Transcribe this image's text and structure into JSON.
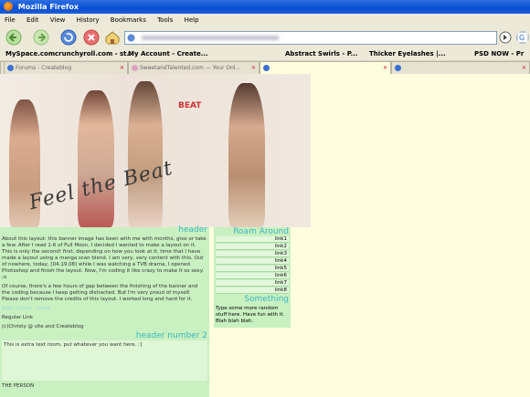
{
  "window": {
    "title": "Mozilla Firefox"
  },
  "menu": [
    "File",
    "Edit",
    "View",
    "History",
    "Bookmarks",
    "Tools",
    "Help"
  ],
  "bookmarks": [
    "MySpace.com",
    "crunchyroll.com - st...",
    "My Account - Create...",
    "Abstract Swirls - P...",
    "Thicker Eyelashes |...",
    "PSD NOW - Pr"
  ],
  "tabs": [
    {
      "label": "Forums - Createblog",
      "active": false
    },
    {
      "label": "SweetandTalented.com — Your Onl...",
      "active": false
    },
    {
      "label": "",
      "active": true
    },
    {
      "label": "",
      "active": false
    }
  ],
  "banner": {
    "beat_tag": "BEAT",
    "title": "Feel the Beat"
  },
  "main": {
    "header": "header",
    "para1": "About this layout: this banner image has been with me with months, give or take a few. After I read 1-6 of Full Moon, I decided I wanted to make a layout on it. This is only the second! first, depending on how you look at it, time that I have made a layout using a manga scan blend. I am very, very content with this. Out of nowhere, today, [04.19.08] while I was watching a TVB drama, I opened Photoshop and finish the layout. Now, I'm coding it like crazy to make it so sexy. ;o",
    "para2": "Of course, there's a few hours of gap between the finishing of the banner and the coding because I keep getting distracted. But I'm very proud of myself. Please don't remove the credits of this layout. I worked long and hard for it.",
    "styled_links": [
      "bold",
      "italics",
      "strike"
    ],
    "regular_link": "Regular Link",
    "credit": "(c)Christy @ site and Createblog",
    "header2": "header number 2",
    "extra_text": "This is extra text room, put whatever you want here. :]",
    "footer_text": "THE PERSON"
  },
  "sidebar": {
    "header": "Roam Around",
    "links": [
      "link1",
      "link2",
      "link3",
      "link4",
      "link5",
      "link6",
      "link7",
      "link8"
    ],
    "header2": "Something",
    "text": "Type some more random stuff here. Have fun with it. Blah blah blah."
  }
}
